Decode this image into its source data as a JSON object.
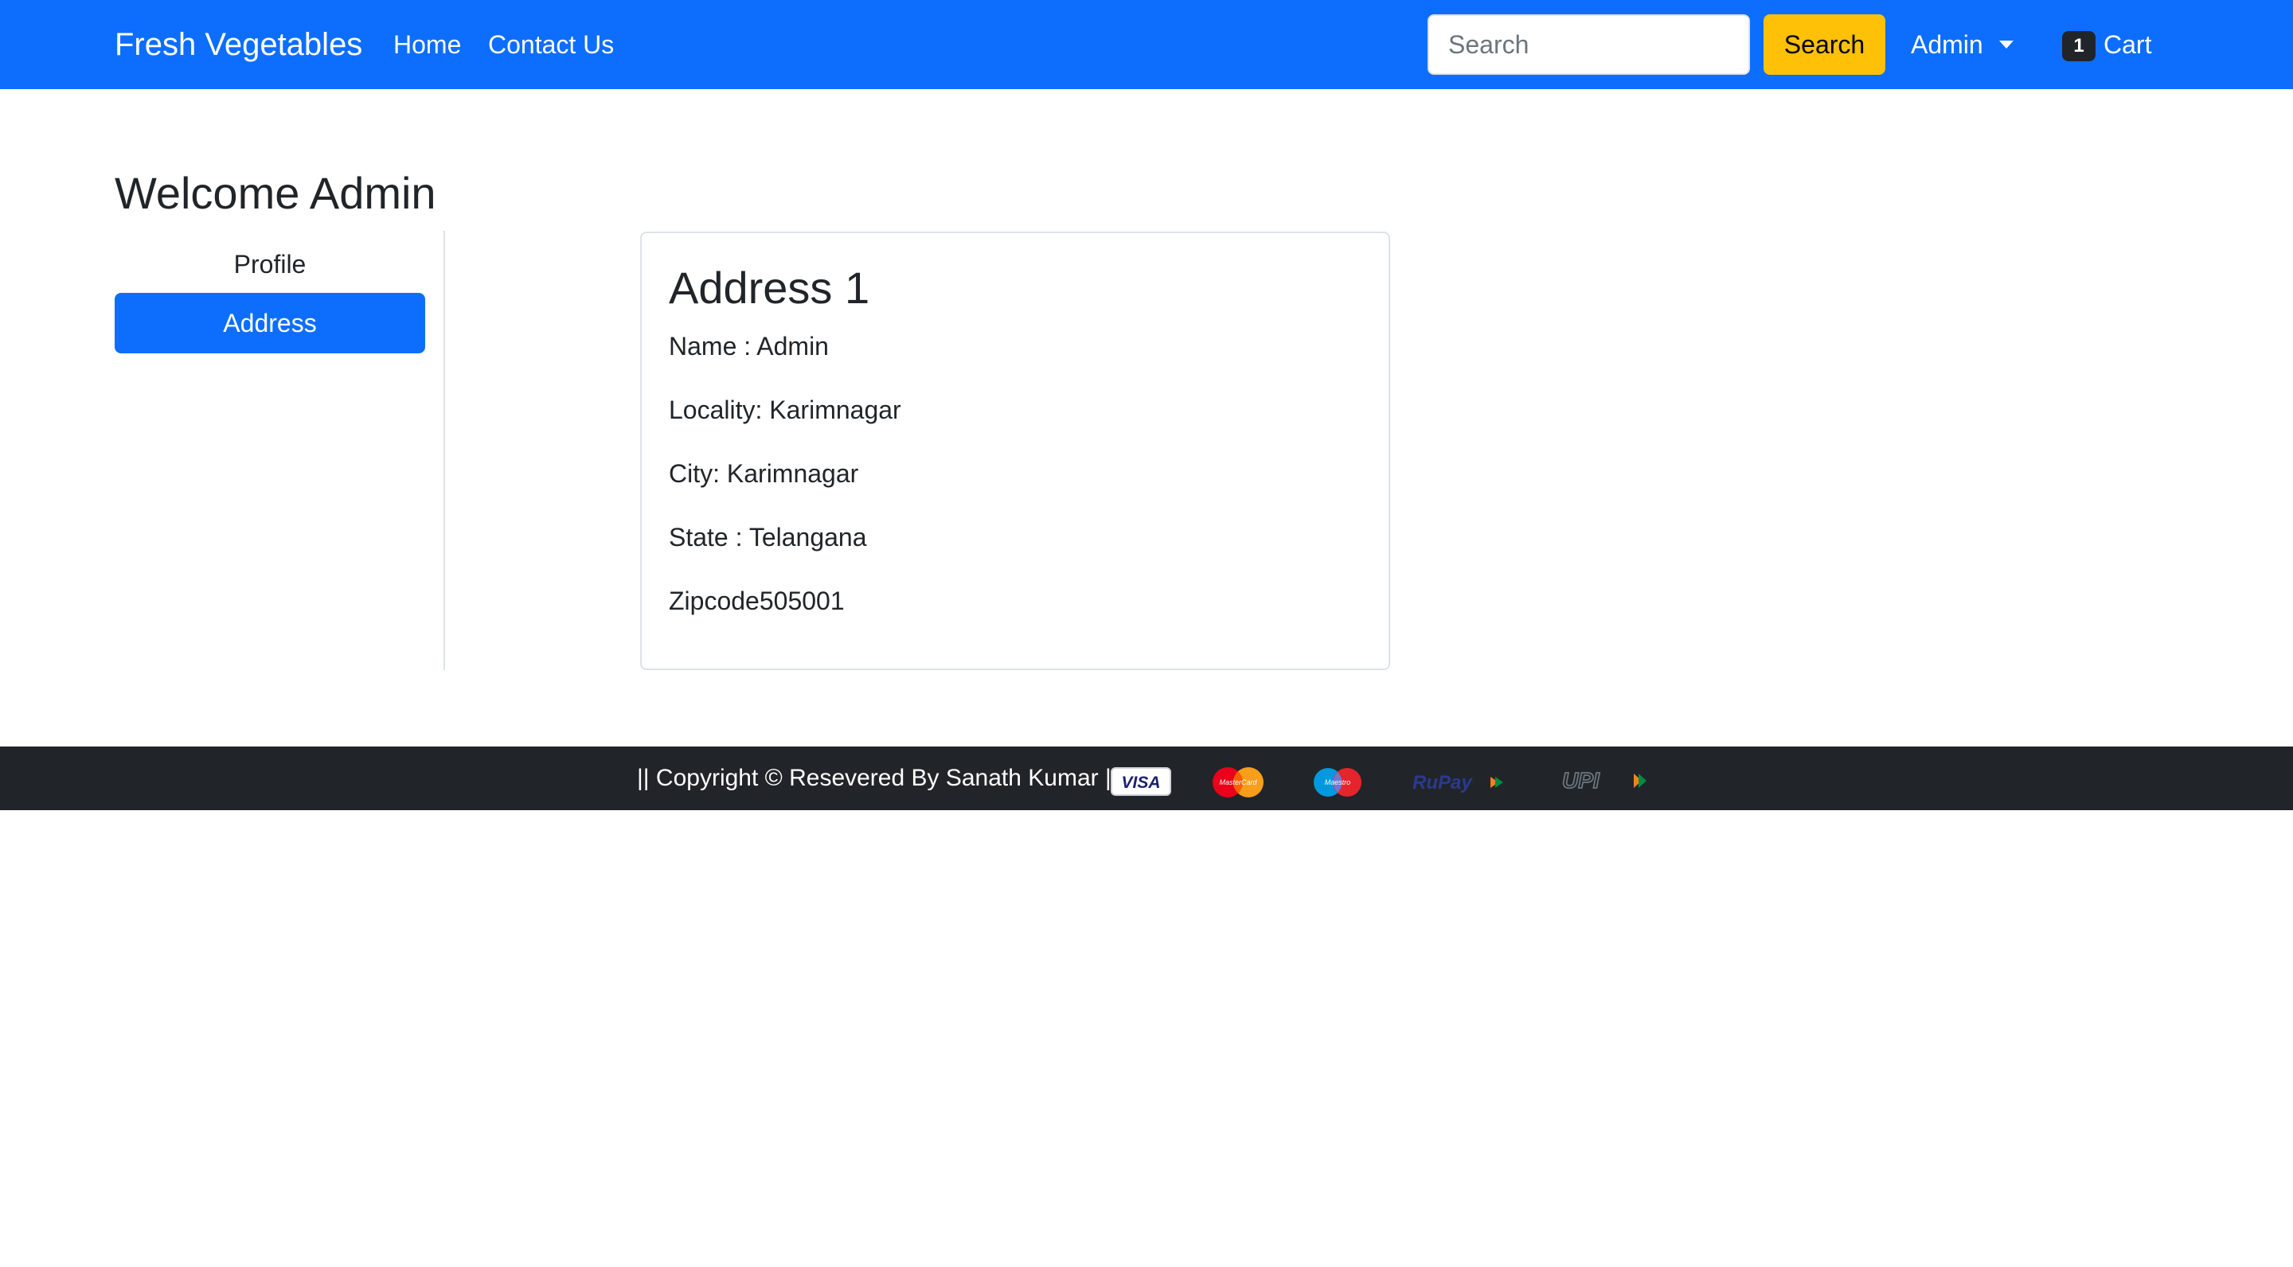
{
  "navbar": {
    "brand": "Fresh Vegetables",
    "links": [
      {
        "label": "Home"
      },
      {
        "label": "Contact Us"
      }
    ],
    "search": {
      "placeholder": "Search",
      "value": "",
      "button_label": "Search"
    },
    "user_menu": {
      "label": "Admin"
    },
    "cart": {
      "count": "1",
      "label": "Cart"
    }
  },
  "main": {
    "welcome": "Welcome Admin",
    "sidebar": {
      "items": [
        {
          "label": "Profile",
          "active": false
        },
        {
          "label": "Address",
          "active": true
        }
      ]
    },
    "address_card": {
      "title": "Address 1",
      "name": "Name : Admin",
      "locality": "Locality: Karimnagar",
      "city": "City: Karimnagar",
      "state": "State : Telangana",
      "zipcode": "Zipcode505001"
    }
  },
  "footer": {
    "copyright": "|| Copyright © Resevered By Sanath Kumar ||",
    "payment_icons": [
      "visa-icon",
      "mastercard-icon",
      "maestro-icon",
      "rupay-icon",
      "upi-icon"
    ]
  },
  "colors": {
    "primary": "#0d6efd",
    "warning": "#ffc107",
    "dark": "#212529",
    "border": "#dee2e6"
  }
}
